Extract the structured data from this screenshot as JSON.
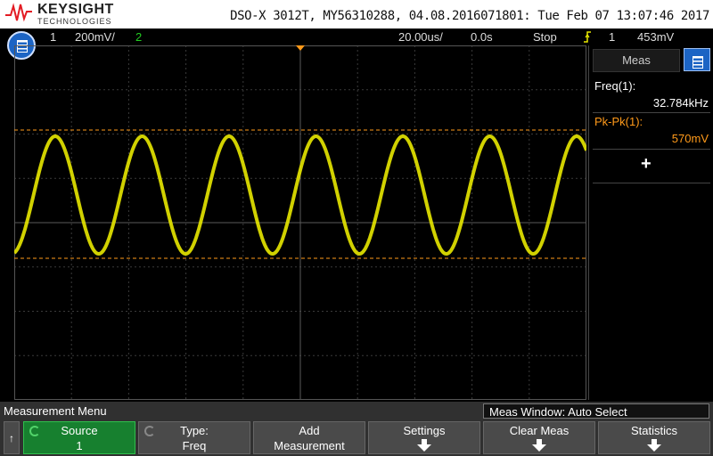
{
  "header": {
    "brand": "KEYSIGHT",
    "brand_sub": "TECHNOLOGIES",
    "device_line": "DSO-X 3012T, MY56310288, 04.08.2016071801: Tue Feb 07 13:07:46 2017"
  },
  "status": {
    "ch1_num": "1",
    "ch1_scale": "200mV/",
    "ch2_num": "2",
    "timebase": "20.00us/",
    "delay": "0.0s",
    "run_state": "Stop",
    "trigger_icon": "trigger-edge-icon",
    "trigger_channel": "1",
    "trigger_level": "453mV"
  },
  "grid_markers": {
    "trigger_marker": "T",
    "channel_marker": "1"
  },
  "panel": {
    "tab_label": "Meas",
    "measurements": [
      {
        "label": "Freq(1):",
        "value": "32.784kHz",
        "color": "#ffffff"
      },
      {
        "label": "Pk-Pk(1):",
        "value": "570mV",
        "color": "#ff9a1a"
      }
    ],
    "add_symbol": "+"
  },
  "bottom": {
    "menu_title": "Measurement Menu",
    "meas_window": "Meas Window: Auto Select",
    "up_arrow": "↑",
    "softkeys": [
      {
        "l1": "Source",
        "l2": "1"
      },
      {
        "l1": "Type:",
        "l2": "Freq"
      },
      {
        "l1": "Add",
        "l2": "Measurement"
      },
      {
        "l1": "Settings",
        "l2": ""
      },
      {
        "l1": "Clear Meas",
        "l2": ""
      },
      {
        "l1": "Statistics",
        "l2": ""
      }
    ]
  },
  "colors": {
    "channel1": "#e8e800",
    "channel2": "#22cc22",
    "cursor": "#ff9a1a",
    "accent": "#1c64c4"
  }
}
